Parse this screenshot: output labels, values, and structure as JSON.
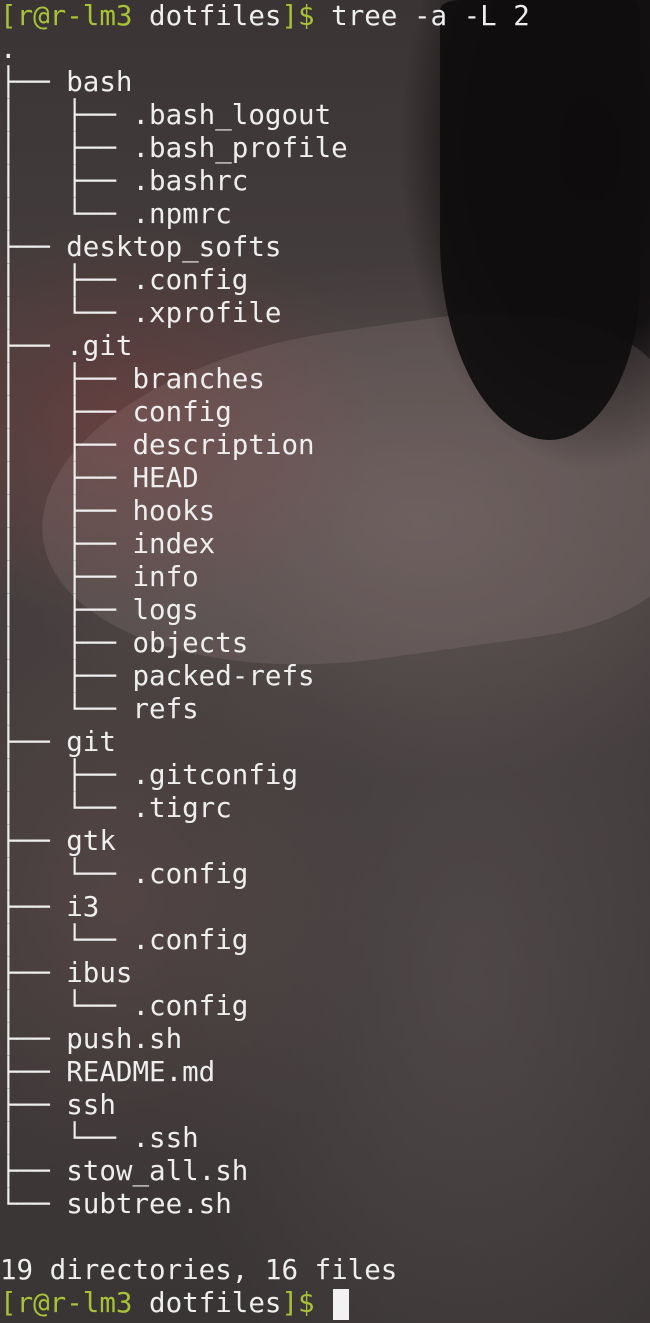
{
  "terminal": {
    "command_prompt": {
      "open_bracket": "[",
      "user_host": "r@r-lm3",
      "directory": " dotfiles",
      "close_bracket": "]$",
      "command": " tree -a -L 2"
    },
    "tree_lines": [
      ".",
      "├── bash",
      "│   ├── .bash_logout",
      "│   ├── .bash_profile",
      "│   ├── .bashrc",
      "│   └── .npmrc",
      "├── desktop_softs",
      "│   ├── .config",
      "│   └── .xprofile",
      "├── .git",
      "│   ├── branches",
      "│   ├── config",
      "│   ├── description",
      "│   ├── HEAD",
      "│   ├── hooks",
      "│   ├── index",
      "│   ├── info",
      "│   ├── logs",
      "│   ├── objects",
      "│   ├── packed-refs",
      "│   └── refs",
      "├── git",
      "│   ├── .gitconfig",
      "│   └── .tigrc",
      "├── gtk",
      "│   └── .config",
      "├── i3",
      "│   └── .config",
      "├── ibus",
      "│   └── .config",
      "├── push.sh",
      "├── README.md",
      "├── ssh",
      "│   └── .ssh",
      "├── stow_all.sh",
      "└── subtree.sh"
    ],
    "summary": "19 directories, 16 files",
    "final_prompt": {
      "open_bracket": "[",
      "user_host": "r@r-lm3",
      "directory": " dotfiles",
      "close_bracket": "]$",
      "command": " "
    },
    "colors": {
      "prompt_green": "#a8c236",
      "text": "#eeeeee",
      "cursor": "#f2f2f2"
    }
  }
}
